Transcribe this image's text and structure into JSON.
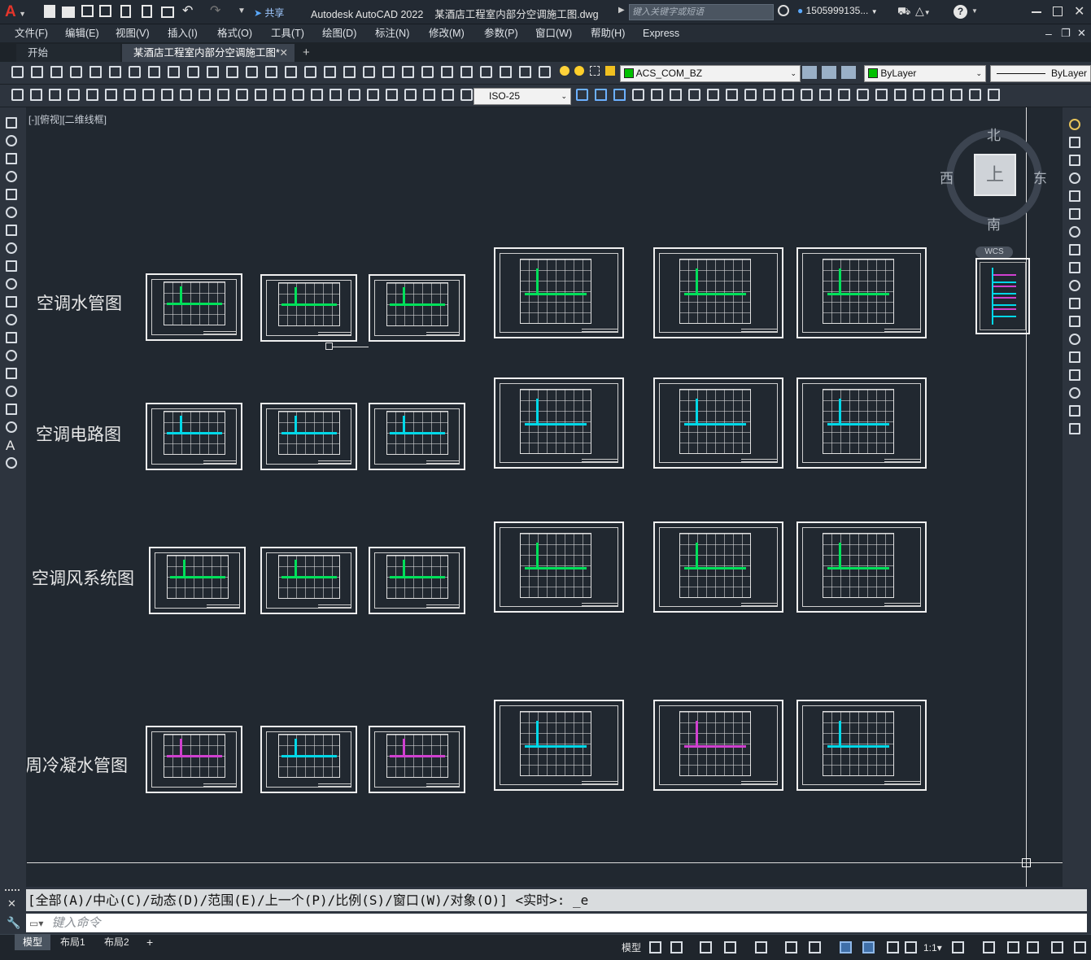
{
  "app": {
    "logo": "A",
    "title": "Autodesk AutoCAD 2022",
    "filename": "某酒店工程室内部分空调施工图.dwg",
    "search_placeholder": "键入关键字或短语",
    "username": "1505999135...",
    "share_label": "共享"
  },
  "menu": [
    "文件(F)",
    "编辑(E)",
    "视图(V)",
    "插入(I)",
    "格式(O)",
    "工具(T)",
    "绘图(D)",
    "标注(N)",
    "修改(M)",
    "参数(P)",
    "窗口(W)",
    "帮助(H)",
    "Express"
  ],
  "tabs": {
    "start": "开始",
    "active": "某酒店工程室内部分空调施工图*",
    "add": "+"
  },
  "toolbar1": {
    "layer_value": "ACS_COM_BZ",
    "color_value": "ByLayer",
    "linetype_value": "ByLayer"
  },
  "toolbar2": {
    "dimstyle_value": "ISO-25"
  },
  "viewport": {
    "label": "[-][俯视][二维线框]"
  },
  "viewcube": {
    "north": "北",
    "south": "南",
    "east": "东",
    "west": "西",
    "face": "上",
    "wcs": "WCS"
  },
  "drawing": {
    "rows": [
      {
        "label": "空调水管图",
        "accent": "#00e05a"
      },
      {
        "label": "空调电路图",
        "accent": "#00c8e0"
      },
      {
        "label": "空调风系统图",
        "accent": "#00e05a"
      },
      {
        "label": "周冷凝水管图",
        "accent": "#d040d0"
      }
    ]
  },
  "command": {
    "history": "[全部(A)/中心(C)/动态(D)/范围(E)/上一个(P)/比例(S)/窗口(W)/对象(O)] <实时>: _e",
    "placeholder": "键入命令"
  },
  "layout_tabs": [
    "模型",
    "布局1",
    "布局2"
  ],
  "status": {
    "model_label": "模型",
    "scale": "1:1"
  },
  "colors": {
    "canvas": "#212830",
    "toolbar": "#2d343e",
    "layer_green": "#00c000",
    "pipe_green": "#00e05a",
    "pipe_cyan": "#00d8e8",
    "pipe_magenta": "#d040d0"
  }
}
